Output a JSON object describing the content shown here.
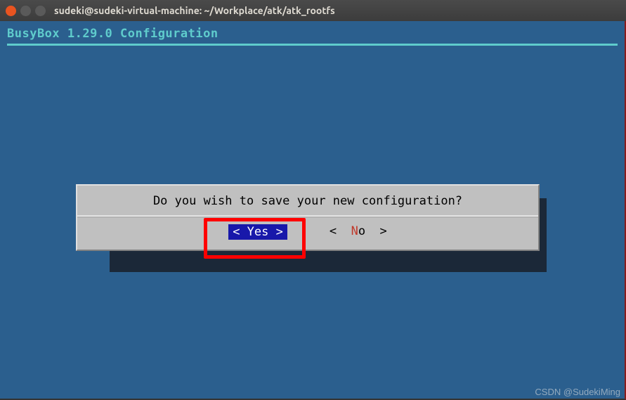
{
  "window": {
    "title": "sudeki@sudeki-virtual-machine: ~/Workplace/atk/atk_rootfs"
  },
  "terminal": {
    "header": "BusyBox 1.29.0 Configuration"
  },
  "dialog": {
    "question": "Do you wish to save your new configuration?",
    "yes": {
      "prefix": "< ",
      "hot": "Y",
      "rest": "es >",
      "full": "< Yes >"
    },
    "no": {
      "prefix": "<  ",
      "hot": "N",
      "rest": "o  >",
      "full": "<  No  >"
    }
  },
  "watermark": "CSDN @SudekiMing"
}
